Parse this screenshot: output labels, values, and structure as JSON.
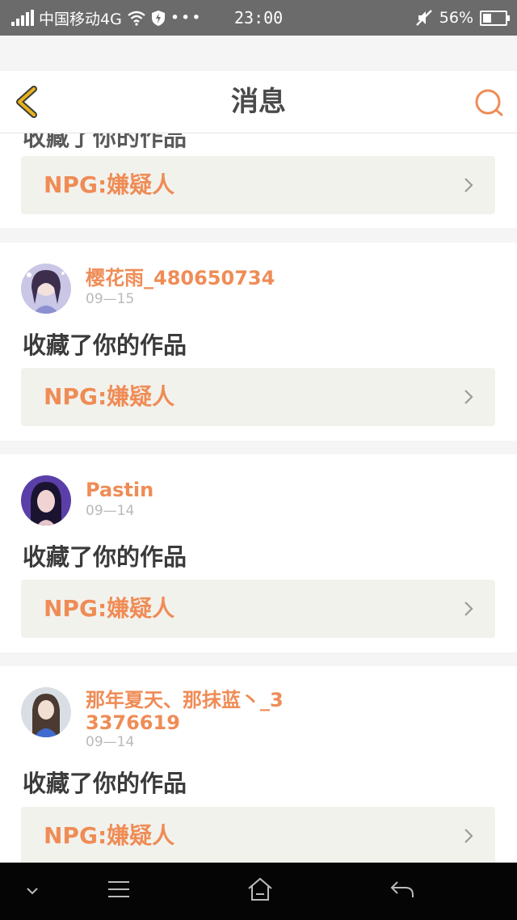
{
  "status_bar": {
    "carrier": "中国移动4G",
    "time": "23:00",
    "battery": "56%",
    "battery_level": 0.56
  },
  "header": {
    "title": "消息"
  },
  "cards": [
    {
      "partial_text": "收藏了你的作品",
      "work_title": "NPG:嫌疑人"
    },
    {
      "user_name": "樱花雨_480650734",
      "date": "09—15",
      "action_text": "收藏了你的作品",
      "work_title": "NPG:嫌疑人"
    },
    {
      "user_name": "Pastin",
      "date": "09—14",
      "action_text": "收藏了你的作品",
      "work_title": "NPG:嫌疑人"
    },
    {
      "user_name": "那年夏天、那抹蓝丶_33376619",
      "date": "09—14",
      "action_text": "收藏了你的作品",
      "work_title": "NPG:嫌疑人"
    }
  ],
  "colors": {
    "accent": "#ef8c56",
    "back_icon": "#e8b21a",
    "workbox_bg": "#f2f2ed"
  }
}
